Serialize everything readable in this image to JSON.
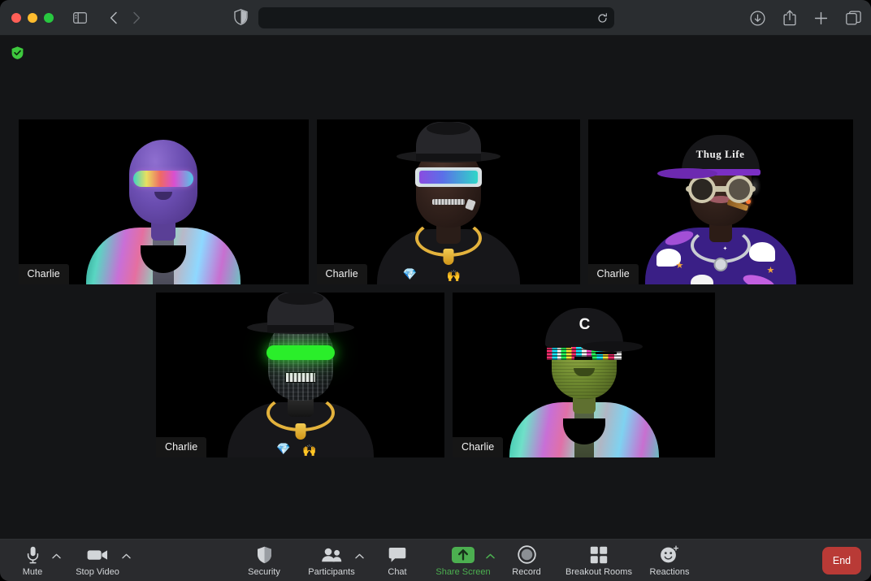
{
  "browser": {
    "traffic_lights": [
      "close",
      "minimize",
      "maximize"
    ],
    "sidebar_icon": "sidebar-icon",
    "back_icon": "chevron-left-icon",
    "forward_icon": "chevron-right-icon",
    "shield_icon": "shield-icon",
    "url_value": "",
    "url_placeholder": "",
    "reload_icon": "reload-icon",
    "downloads_icon": "download-icon",
    "share_icon": "share-icon",
    "new_tab_icon": "plus-icon",
    "tabs_icon": "tab-overview-icon"
  },
  "page": {
    "secure_badge_icon": "shield-check-icon",
    "secure_badge_color": "#3ec93e"
  },
  "meeting": {
    "participants": [
      {
        "name": "Charlie",
        "avatar": "purple-visor-holo"
      },
      {
        "name": "Charlie",
        "avatar": "fedora-cyber-visor-zipped"
      },
      {
        "name": "Charlie",
        "avatar": "thug-life-cap-goggles-cigar"
      },
      {
        "name": "Charlie",
        "avatar": "fedora-green-laser-glitch"
      },
      {
        "name": "Charlie",
        "avatar": "c-cap-glitch-visor-green"
      }
    ],
    "avatar_details": {
      "thug_life_cap_text": "Thug Life",
      "c_cap_text": "C",
      "diamond_emoji": "💎",
      "hands_emoji": "🙌"
    }
  },
  "toolbar": {
    "controls": [
      {
        "id": "mute",
        "label": "Mute",
        "icon": "microphone-icon",
        "has_caret": true,
        "active": false
      },
      {
        "id": "stop-video",
        "label": "Stop Video",
        "icon": "video-camera-icon",
        "has_caret": true,
        "active": false
      },
      {
        "id": "security",
        "label": "Security",
        "icon": "shield-icon",
        "has_caret": false,
        "active": false
      },
      {
        "id": "participants",
        "label": "Participants",
        "icon": "people-icon",
        "has_caret": true,
        "active": false
      },
      {
        "id": "chat",
        "label": "Chat",
        "icon": "chat-bubble-icon",
        "has_caret": false,
        "active": false
      },
      {
        "id": "share-screen",
        "label": "Share Screen",
        "icon": "share-screen-icon",
        "has_caret": true,
        "active": true
      },
      {
        "id": "record",
        "label": "Record",
        "icon": "record-icon",
        "has_caret": false,
        "active": false
      },
      {
        "id": "breakout-rooms",
        "label": "Breakout Rooms",
        "icon": "grid-squares-icon",
        "has_caret": false,
        "active": false
      },
      {
        "id": "reactions",
        "label": "Reactions",
        "icon": "smiley-plus-icon",
        "has_caret": false,
        "active": false
      }
    ],
    "end_label": "End",
    "end_color": "#b93a36",
    "accent_color": "#4caf50"
  }
}
